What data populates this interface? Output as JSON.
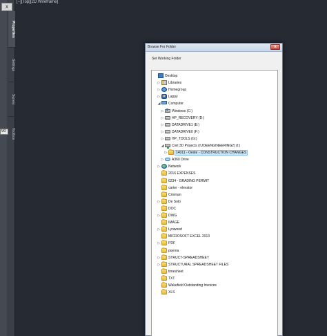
{
  "viewport_label": "[−][Top][2D Wireframe]",
  "palette": {
    "top_button": "x",
    "tabs": [
      "Properties",
      "Settings",
      "Survey",
      "Toolbox"
    ],
    "cutoff_value": "90"
  },
  "dialog": {
    "title": "Browse For Folder",
    "close_label": "x",
    "instruction": "Set Working Folder",
    "tree": [
      {
        "label": "Desktop",
        "icon": "desktop-icon",
        "level": 0,
        "expander": ""
      },
      {
        "label": "Libraries",
        "icon": "libraries-icon",
        "level": 1,
        "expander": "▷"
      },
      {
        "label": "Homegroup",
        "icon": "homegroup-icon",
        "level": 1,
        "expander": "▷"
      },
      {
        "label": "Lappy",
        "icon": "user-icon",
        "level": 1,
        "expander": "▷"
      },
      {
        "label": "Computer",
        "icon": "computer-icon",
        "level": 1,
        "expander": "◢"
      },
      {
        "label": "Windows (C:)",
        "icon": "system-drive-icon",
        "level": 2,
        "expander": "▷"
      },
      {
        "label": "HP_RECOVERY (D:)",
        "icon": "drive-icon",
        "level": 2,
        "expander": "▷"
      },
      {
        "label": "DATADRIVE1 (E:)",
        "icon": "drive-icon",
        "level": 2,
        "expander": "▷"
      },
      {
        "label": "DATADRIVE0 (F:)",
        "icon": "drive-icon",
        "level": 2,
        "expander": "▷"
      },
      {
        "label": "HP_TOOLS (G:)",
        "icon": "drive-icon",
        "level": 2,
        "expander": "▷"
      },
      {
        "label": "Civil 3D Projects (\\\\JOEENGINEERING2) (I:)",
        "icon": "network-drive-icon",
        "level": 2,
        "expander": "◢"
      },
      {
        "label": "14011 - Oeste - CONSTRUCTION CHANGES",
        "icon": "folder-icon",
        "level": 3,
        "expander": "▷",
        "selected": true
      },
      {
        "label": "A360 Drive",
        "icon": "cloud-icon",
        "level": 2,
        "expander": "▷"
      },
      {
        "label": "Network",
        "icon": "network-icon",
        "level": 1,
        "expander": "▷"
      },
      {
        "label": "2016 EXPENSES",
        "icon": "folder-icon",
        "level": 1,
        "expander": ""
      },
      {
        "label": "6234  - GRADING PERMIT",
        "icon": "folder-icon",
        "level": 1,
        "expander": ""
      },
      {
        "label": "carter - elevator",
        "icon": "folder-icon",
        "level": 1,
        "expander": ""
      },
      {
        "label": "Crisman",
        "icon": "folder-icon",
        "level": 1,
        "expander": ""
      },
      {
        "label": "De Soto",
        "icon": "folder-icon",
        "level": 1,
        "expander": "▷"
      },
      {
        "label": "DOC",
        "icon": "folder-icon",
        "level": 1,
        "expander": ""
      },
      {
        "label": "DWG",
        "icon": "folder-icon",
        "level": 1,
        "expander": "▷"
      },
      {
        "label": "IMAGE",
        "icon": "folder-icon",
        "level": 1,
        "expander": ""
      },
      {
        "label": "Lynwood",
        "icon": "folder-icon",
        "level": 1,
        "expander": "▷"
      },
      {
        "label": "MICROSOFT EXCEL 2013",
        "icon": "folder-icon",
        "level": 1,
        "expander": ""
      },
      {
        "label": "PDF",
        "icon": "folder-icon",
        "level": 1,
        "expander": "▷"
      },
      {
        "label": "poema",
        "icon": "folder-icon",
        "level": 1,
        "expander": ""
      },
      {
        "label": "STRUCT-SPREADSHEET",
        "icon": "folder-icon",
        "level": 1,
        "expander": "▷"
      },
      {
        "label": "STRUCTURAL SPREADSHEET FILES",
        "icon": "folder-icon",
        "level": 1,
        "expander": "▷"
      },
      {
        "label": "timesheet",
        "icon": "folder-icon",
        "level": 1,
        "expander": ""
      },
      {
        "label": "TXT",
        "icon": "folder-icon",
        "level": 1,
        "expander": ""
      },
      {
        "label": "Wakefield Outstanding Invoices",
        "icon": "folder-icon",
        "level": 1,
        "expander": ""
      },
      {
        "label": "XLS",
        "icon": "folder-icon",
        "level": 1,
        "expander": ""
      }
    ]
  }
}
